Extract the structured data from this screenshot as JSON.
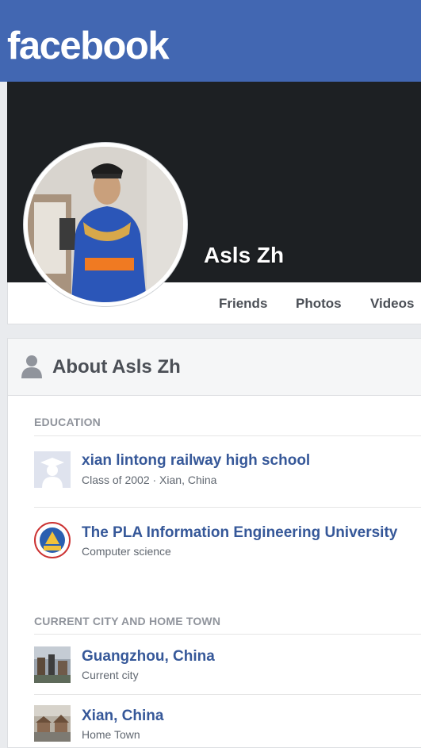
{
  "header": {
    "logo": "facebook"
  },
  "profile": {
    "name": "Asls Zh",
    "nav": [
      "Friends",
      "Photos",
      "Videos"
    ]
  },
  "about": {
    "title": "About Asls Zh",
    "education_label": "EDUCATION",
    "education": [
      {
        "title": "xian lintong railway high school",
        "subtitle": "Class of 2002 · Xian, China"
      },
      {
        "title": "The PLA Information Engineering University",
        "subtitle": "Computer science"
      }
    ],
    "places_label": "CURRENT CITY AND HOME TOWN",
    "places": [
      {
        "title": "Guangzhou, China",
        "subtitle": "Current city"
      },
      {
        "title": "Xian, China",
        "subtitle": "Home Town"
      }
    ]
  },
  "colors": {
    "brand": "#4267b2",
    "link": "#365899",
    "cover": "#1d2023"
  }
}
